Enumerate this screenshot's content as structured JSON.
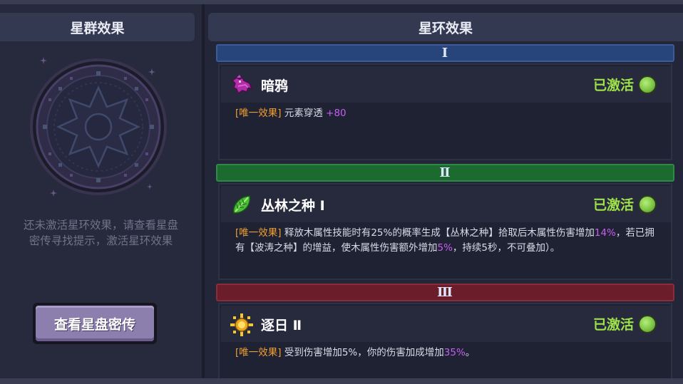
{
  "left": {
    "title": "星群效果",
    "hint_line1": "还未激活星环效果，请查看星盘",
    "hint_line2": "密传寻找提示，激活星环效果",
    "button_label": "查看星盘密传"
  },
  "right": {
    "title": "星环效果",
    "tiers": [
      {
        "numeral": "Ⅰ",
        "color": "#27457a",
        "effect_name": "暗鸦",
        "icon": "crow-icon",
        "status": "已激活",
        "tag": "[唯一效果]",
        "desc_parts": [
          "元素穿透 ",
          "+80"
        ]
      },
      {
        "numeral": "Ⅱ",
        "color": "#1d6a30",
        "effect_name": "丛林之种 Ⅰ",
        "icon": "jungle-seed-icon",
        "status": "已激活",
        "tag": "[唯一效果]",
        "desc_parts": [
          "释放木属性技能时有25%的概率生成【丛林之种】拾取后木属性伤害增加",
          "14%",
          "，若已拥有【波涛之种】的增益，使木属性伤害额外增加",
          "5%",
          "，持续5秒，不可叠加）。"
        ]
      },
      {
        "numeral": "Ⅲ",
        "color": "#6b1d2a",
        "effect_name": "逐日 Ⅱ",
        "icon": "sun-icon",
        "status": "已激活",
        "tag": "[唯一效果]",
        "desc_parts": [
          "受到伤害增加5%，你的伤害加成增加",
          "35%",
          "。"
        ]
      }
    ]
  }
}
